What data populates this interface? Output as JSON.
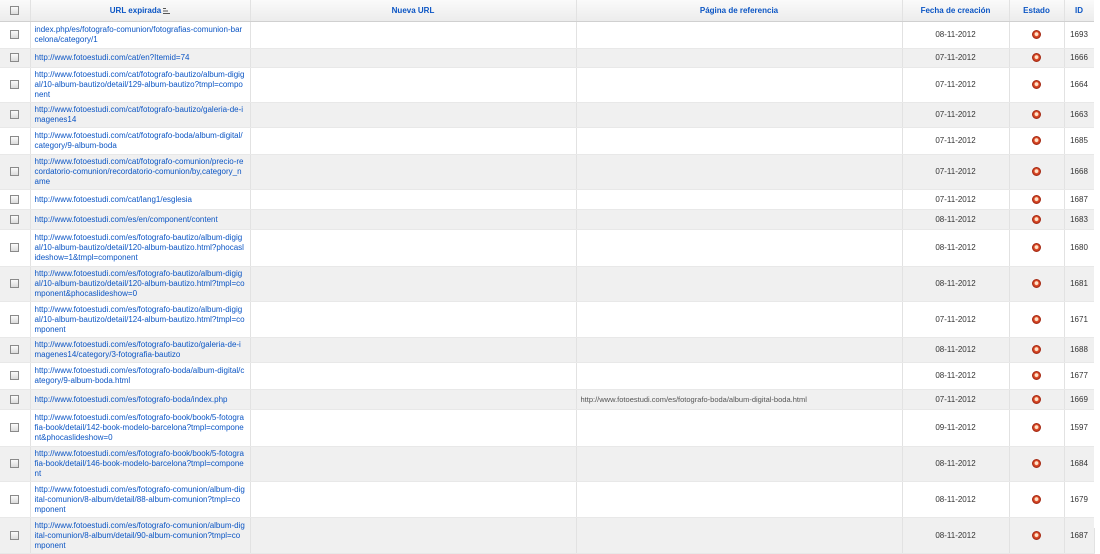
{
  "header": {
    "select_all_label": "",
    "url_expired": "URL expirada",
    "new_url": "Nueva URL",
    "referer": "Página de referencia",
    "created": "Fecha de creación",
    "state": "Estado",
    "id": "ID"
  },
  "rows": [
    {
      "url": "index.php/es/fotografo-comunion/fotografias-comunion-barcelona/category/1",
      "new_url": "",
      "referer": "",
      "date": "08-11-2012",
      "id": "1693",
      "h": 27
    },
    {
      "url": "http://www.fotoestudi.com/cat/en?Itemid=74",
      "new_url": "",
      "referer": "",
      "date": "07-11-2012",
      "id": "1666",
      "h": 19
    },
    {
      "url": "http://www.fotoestudi.com/cat/fotografo-bautizo/album-digigal/10-album-bautizo/detail/129-album-bautizo?tmpl=component",
      "new_url": "",
      "referer": "",
      "date": "07-11-2012",
      "id": "1664",
      "h": 27
    },
    {
      "url": "http://www.fotoestudi.com/cat/fotografo-bautizo/galeria-de-imagenes14",
      "new_url": "",
      "referer": "",
      "date": "07-11-2012",
      "id": "1663",
      "h": 25
    },
    {
      "url": "http://www.fotoestudi.com/cat/fotografo-boda/album-digital/category/9-album-boda",
      "new_url": "",
      "referer": "",
      "date": "07-11-2012",
      "id": "1685",
      "h": 27
    },
    {
      "url": "http://www.fotoestudi.com/cat/fotografo-comunion/precio-recordatorio-comunion/recordatorio-comunion/by,category_name",
      "new_url": "",
      "referer": "",
      "date": "07-11-2012",
      "id": "1668",
      "h": 35
    },
    {
      "url": "http://www.fotoestudi.com/cat/lang1/esglesia",
      "new_url": "",
      "referer": "",
      "date": "07-11-2012",
      "id": "1687",
      "h": 20
    },
    {
      "url": "http://www.fotoestudi.com/es/en/component/content",
      "new_url": "",
      "referer": "",
      "date": "08-11-2012",
      "id": "1683",
      "h": 20
    },
    {
      "url": "http://www.fotoestudi.com/es/fotografo-bautizo/album-digigal/10-album-bautizo/detail/120-album-bautizo.html?phocaslideshow=1&tmpl=component",
      "new_url": "",
      "referer": "",
      "date": "08-11-2012",
      "id": "1680",
      "h": 37
    },
    {
      "url": "http://www.fotoestudi.com/es/fotografo-bautizo/album-digigal/10-album-bautizo/detail/120-album-bautizo.html?tmpl=component&phocaslideshow=0",
      "new_url": "",
      "referer": "",
      "date": "08-11-2012",
      "id": "1681",
      "h": 35
    },
    {
      "url": "http://www.fotoestudi.com/es/fotografo-bautizo/album-digigal/10-album-bautizo/detail/124-album-bautizo.html?tmpl=component",
      "new_url": "",
      "referer": "",
      "date": "07-11-2012",
      "id": "1671",
      "h": 36
    },
    {
      "url": "http://www.fotoestudi.com/es/fotografo-bautizo/galeria-de-imagenes14/category/3-fotografia-bautizo",
      "new_url": "",
      "referer": "",
      "date": "08-11-2012",
      "id": "1688",
      "h": 25
    },
    {
      "url": "http://www.fotoestudi.com/es/fotografo-boda/album-digital/category/9-album-boda.html",
      "new_url": "",
      "referer": "",
      "date": "08-11-2012",
      "id": "1677",
      "h": 27
    },
    {
      "url": "http://www.fotoestudi.com/es/fotografo-boda/index.php",
      "new_url": "",
      "referer": "http://www.fotoestudi.com/es/fotografo-boda/album-digital-boda.html",
      "date": "07-11-2012",
      "id": "1669",
      "h": 20
    },
    {
      "url": "http://www.fotoestudi.com/es/fotografo-book/book/5-fotografia-book/detail/142-book-modelo-barcelona?tmpl=component&phocaslideshow=0",
      "new_url": "",
      "referer": "",
      "date": "09-11-2012",
      "id": "1597",
      "h": 37
    },
    {
      "url": "http://www.fotoestudi.com/es/fotografo-book/book/5-fotografia-book/detail/146-book-modelo-barcelona?tmpl=component",
      "new_url": "",
      "referer": "",
      "date": "08-11-2012",
      "id": "1684",
      "h": 26
    },
    {
      "url": "http://www.fotoestudi.com/es/fotografo-comunion/album-digital-comunion/8-album/detail/88-album-comunion?tmpl=component",
      "new_url": "",
      "referer": "",
      "date": "08-11-2012",
      "id": "1679",
      "h": 36
    },
    {
      "url": "http://www.fotoestudi.com/es/fotografo-comunion/album-digital-comunion/8-album/detail/90-album-comunion?tmpl=component",
      "new_url": "",
      "referer": "",
      "date": "08-11-2012",
      "id": "1687",
      "h": 36
    }
  ]
}
